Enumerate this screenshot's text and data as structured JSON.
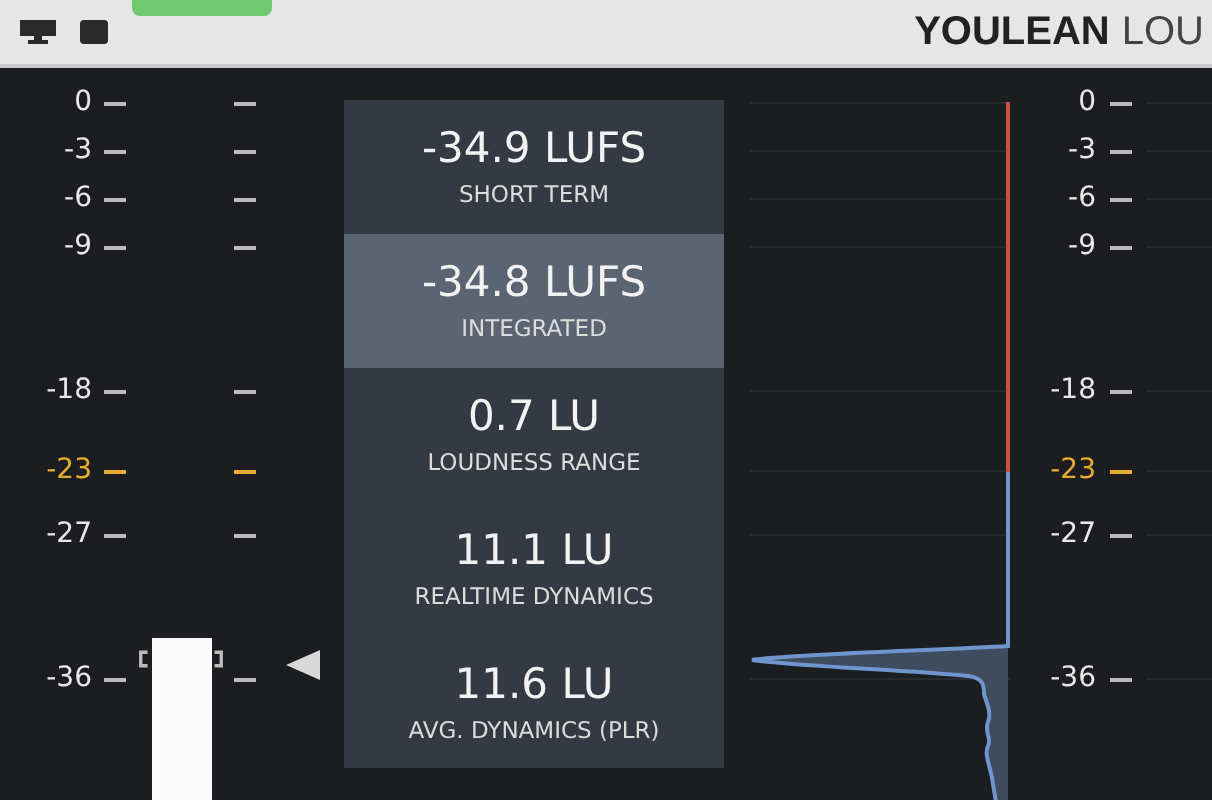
{
  "header": {
    "brand": "YOULEAN",
    "title_rest": "LOU"
  },
  "scale_left": [
    {
      "label": "0",
      "target": false
    },
    {
      "label": "-3",
      "target": false
    },
    {
      "label": "-6",
      "target": false
    },
    {
      "label": "-9",
      "target": false
    },
    {
      "label": "-18",
      "target": false
    },
    {
      "label": "-23",
      "target": true
    },
    {
      "label": "-27",
      "target": false
    },
    {
      "label": "-36",
      "target": false
    }
  ],
  "stats": [
    {
      "value": "-34.9 LUFS",
      "label": "SHORT TERM",
      "selected": false
    },
    {
      "value": "-34.8 LUFS",
      "label": "INTEGRATED",
      "selected": true
    },
    {
      "value": "0.7 LU",
      "label": "LOUDNESS RANGE",
      "selected": false
    },
    {
      "value": "11.1 LU",
      "label": "REALTIME DYNAMICS",
      "selected": false
    },
    {
      "value": "11.6 LU",
      "label": "AVG. DYNAMICS (PLR)",
      "selected": false
    }
  ],
  "scale_right": [
    {
      "label": "0",
      "target": false
    },
    {
      "label": "-3",
      "target": false
    },
    {
      "label": "-6",
      "target": false
    },
    {
      "label": "-9",
      "target": false
    },
    {
      "label": "-18",
      "target": false
    },
    {
      "label": "-23",
      "target": true
    },
    {
      "label": "-27",
      "target": false
    },
    {
      "label": "-36",
      "target": false
    }
  ]
}
